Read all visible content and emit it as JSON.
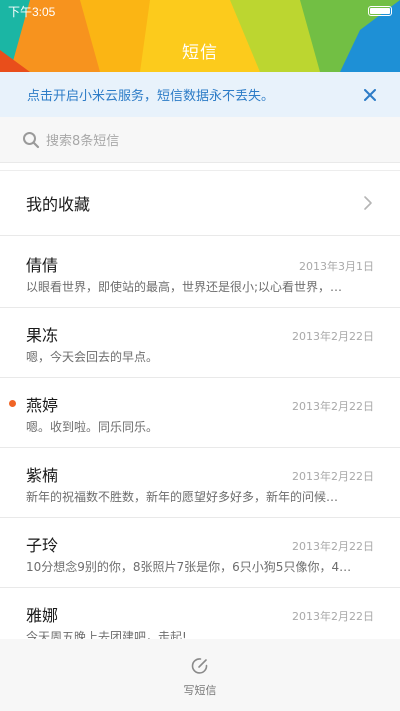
{
  "status_bar": {
    "time": "下午3:05"
  },
  "header": {
    "title": "短信"
  },
  "notice": {
    "text": "点击开启小米云服务，短信数据永不丢失。",
    "close_icon": "close-icon"
  },
  "search": {
    "placeholder": "搜索8条短信"
  },
  "favorites": {
    "label": "我的收藏"
  },
  "conversations": [
    {
      "name": "倩倩",
      "date": "2013年3月1日",
      "preview": "以眼看世界，即使站的最高，世界还是很小;以心看世界，…",
      "unread": false
    },
    {
      "name": "果冻",
      "date": "2013年2月22日",
      "preview": "嗯，今天会回去的早点。",
      "unread": false
    },
    {
      "name": "燕婷",
      "date": "2013年2月22日",
      "preview": "嗯。收到啦。同乐同乐。",
      "unread": true
    },
    {
      "name": "紫楠",
      "date": "2013年2月22日",
      "preview": "新年的祝福数不胜数，新年的愿望好多好多，新年的问候…",
      "unread": false
    },
    {
      "name": "子玲",
      "date": "2013年2月22日",
      "preview": "10分想念9别的你，8张照片7张是你，6只小狗5只像你，4…",
      "unread": false
    },
    {
      "name": "雅娜",
      "date": "2013年2月22日",
      "preview": "今天周五晚上去团建吧，走起!",
      "unread": false
    }
  ],
  "bottom_bar": {
    "compose_label": "写短信"
  },
  "colors": {
    "accent_blue": "#2d7cc7",
    "unread_dot": "#f06425",
    "header_orange": "#f7931e",
    "header_yellow": "#fccb1c",
    "header_green": "#8cc63f",
    "header_teal": "#1bb6a4",
    "header_blue": "#1e90d6"
  }
}
